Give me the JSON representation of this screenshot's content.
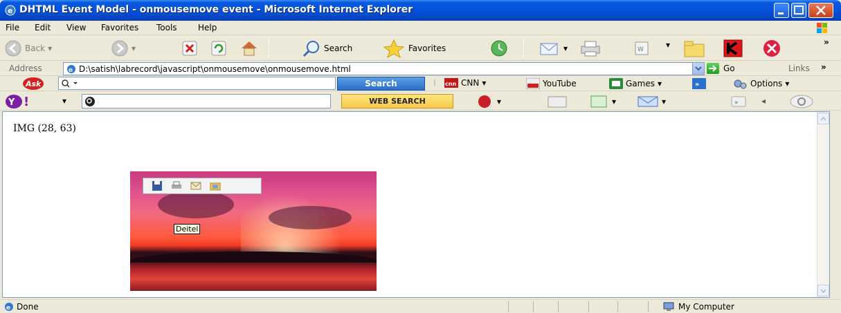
{
  "window": {
    "title": "DHTML Event Model - onmousemove event - Microsoft Internet Explorer"
  },
  "menu": [
    "File",
    "Edit",
    "View",
    "Favorites",
    "Tools",
    "Help"
  ],
  "toolbar": {
    "back_label": "Back",
    "search_label": "Search",
    "favorites_label": "Favorites"
  },
  "address": {
    "label": "Address",
    "url": "D:\\satish\\labrecord\\javascript\\onmousemove\\onmousemove.html",
    "go_label": "Go",
    "links_label": "Links"
  },
  "ask": {
    "search_label": "Search",
    "cnn_label": "CNN",
    "youtube_label": "YouTube",
    "games_label": "Games",
    "options_label": "Options"
  },
  "yahoo": {
    "web_search_label": "WEB SEARCH"
  },
  "content": {
    "coords_text": "IMG (28, 63)",
    "tooltip": "Deitel"
  },
  "status": {
    "text": "Done",
    "zone": "My Computer"
  },
  "colors": {
    "titlebar": "#0451d8",
    "chrome": "#ECE9D8",
    "ask_search": "#2a6fcc",
    "yahoo_search": "#f7c94a"
  }
}
